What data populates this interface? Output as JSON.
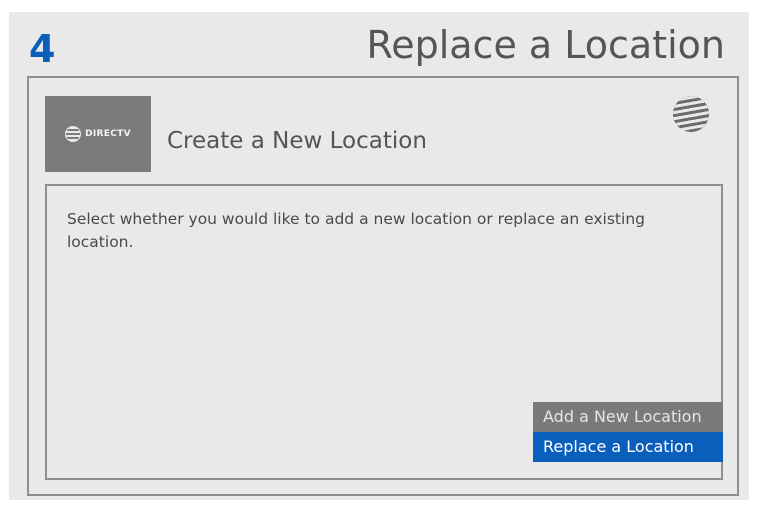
{
  "header": {
    "step_number": "4",
    "title": "Replace a Location"
  },
  "screen": {
    "logo_text": "DIRECTV",
    "title": "Create a New Location",
    "instructions": "Select whether you would like to add a new location or replace an existing location.",
    "options": [
      {
        "label": "Add a New Location",
        "selected": false
      },
      {
        "label": "Replace a Location",
        "selected": true
      }
    ],
    "icons": {
      "brand_logo": "directv-logo",
      "carrier_logo": "att-globe-icon"
    }
  },
  "colors": {
    "step_accent": "#0b5fb8",
    "selected_option": "#0a5fbc",
    "unselected_option": "#7a7a7a"
  }
}
